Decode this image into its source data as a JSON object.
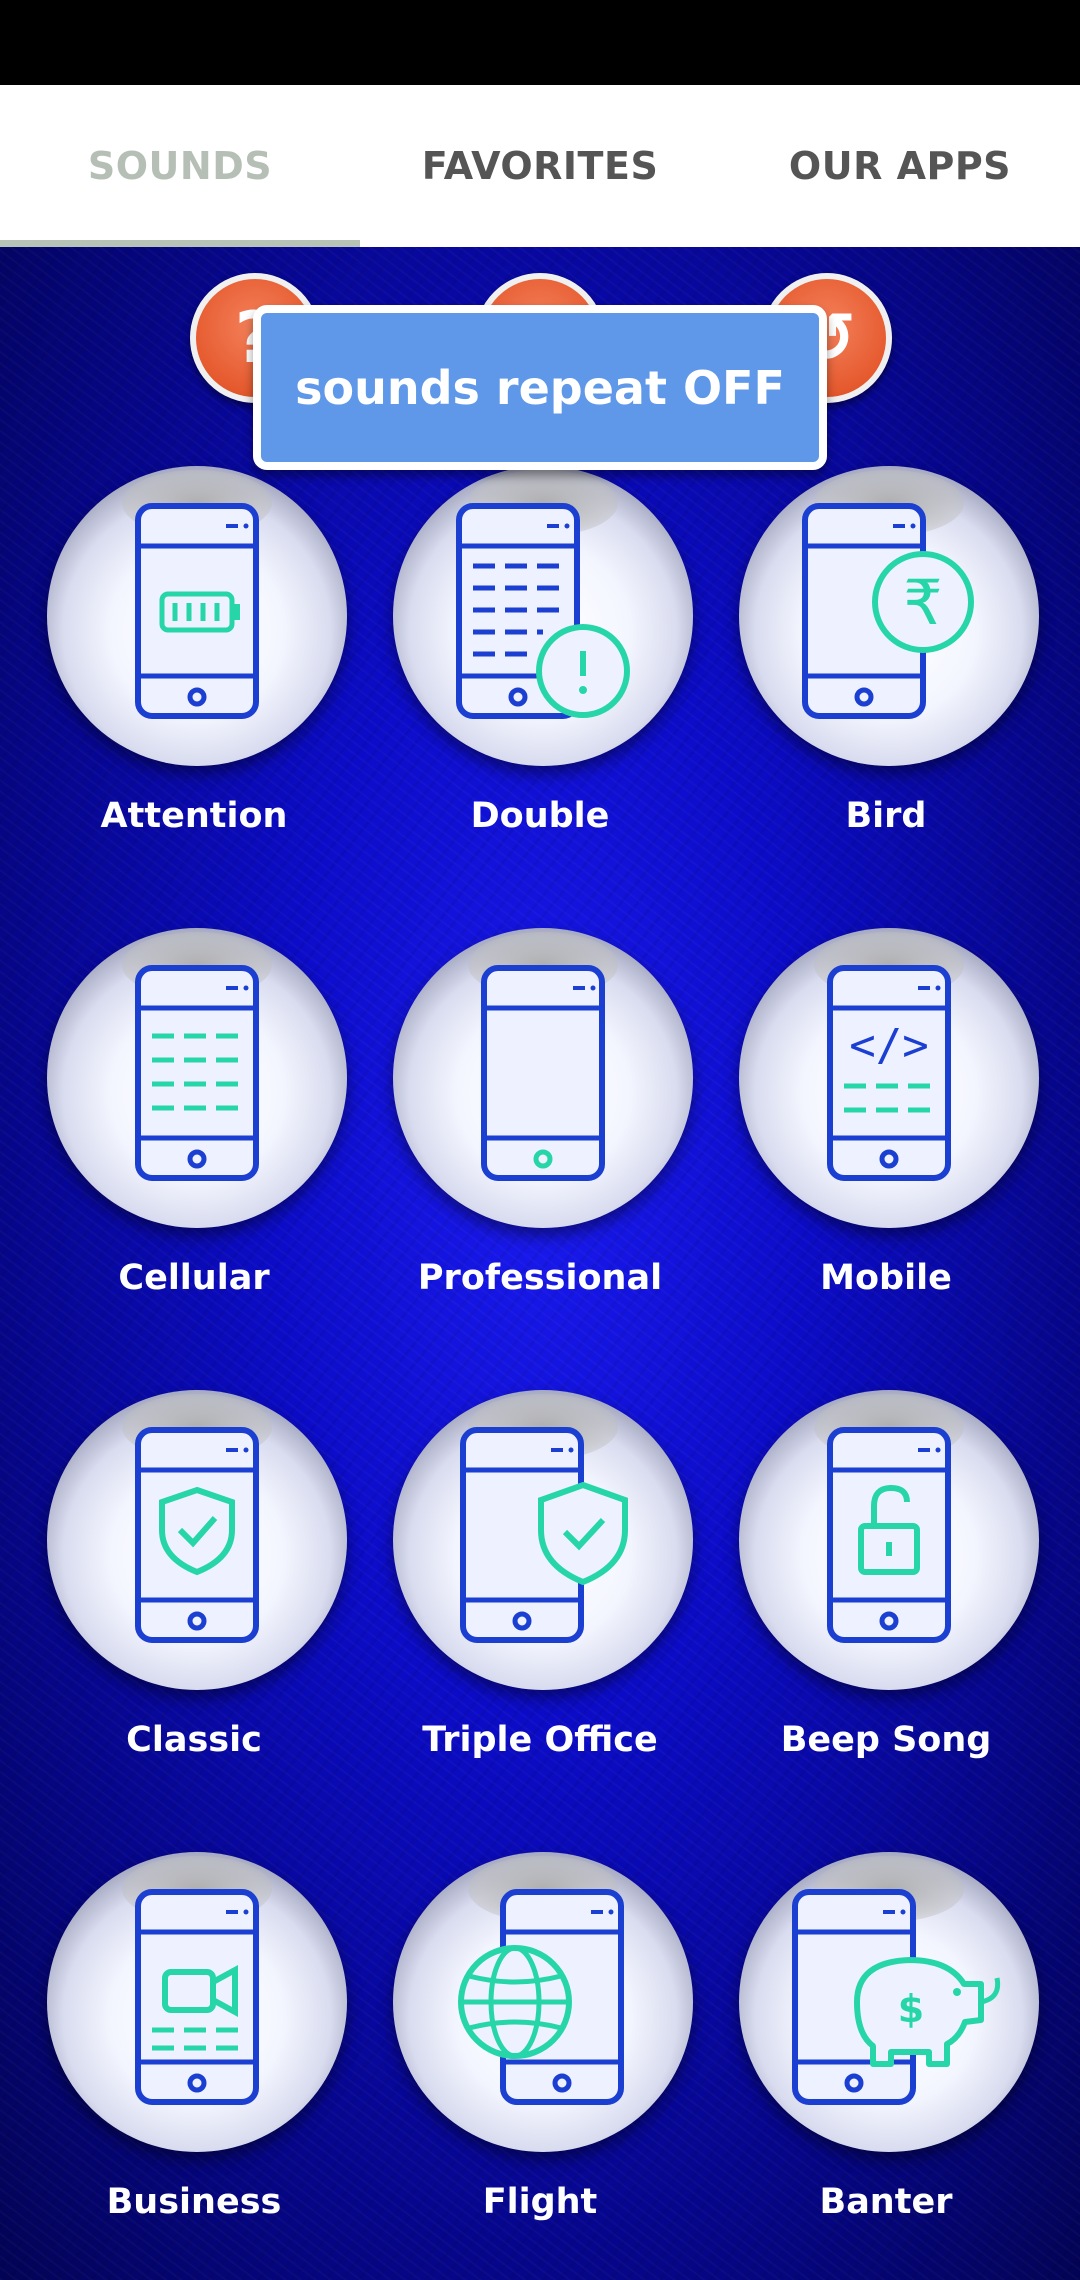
{
  "tabs": [
    {
      "label": "SOUNDS",
      "active": true
    },
    {
      "label": "FAVORITES",
      "active": false
    },
    {
      "label": "OUR APPS",
      "active": false
    }
  ],
  "toast": {
    "text": "sounds repeat OFF"
  },
  "top_buttons": [
    {
      "icon": "help-icon"
    },
    {
      "icon": "repeat-icon"
    },
    {
      "icon": "refresh-icon"
    }
  ],
  "colors": {
    "phone": "#1a3fd1",
    "accent": "#27d6a8",
    "toast": "#5f98e8",
    "tab_active": "#b5bfb5",
    "orange": "#e65a2f"
  },
  "sounds": [
    {
      "label": "Attention",
      "icon": "phone-battery-icon"
    },
    {
      "label": "Double",
      "icon": "phone-alert-icon"
    },
    {
      "label": "Bird",
      "icon": "phone-rupee-icon"
    },
    {
      "label": "Cellular",
      "icon": "phone-text-icon"
    },
    {
      "label": "Professional",
      "icon": "phone-icon"
    },
    {
      "label": "Mobile",
      "icon": "phone-code-icon"
    },
    {
      "label": "Classic",
      "icon": "phone-shield-icon"
    },
    {
      "label": "Triple Office",
      "icon": "phone-shield-check-icon"
    },
    {
      "label": "Beep Song",
      "icon": "phone-unlock-icon"
    },
    {
      "label": "Business",
      "icon": "phone-video-icon"
    },
    {
      "label": "Flight",
      "icon": "phone-globe-icon"
    },
    {
      "label": "Banter",
      "icon": "phone-piggy-bank-icon"
    }
  ]
}
